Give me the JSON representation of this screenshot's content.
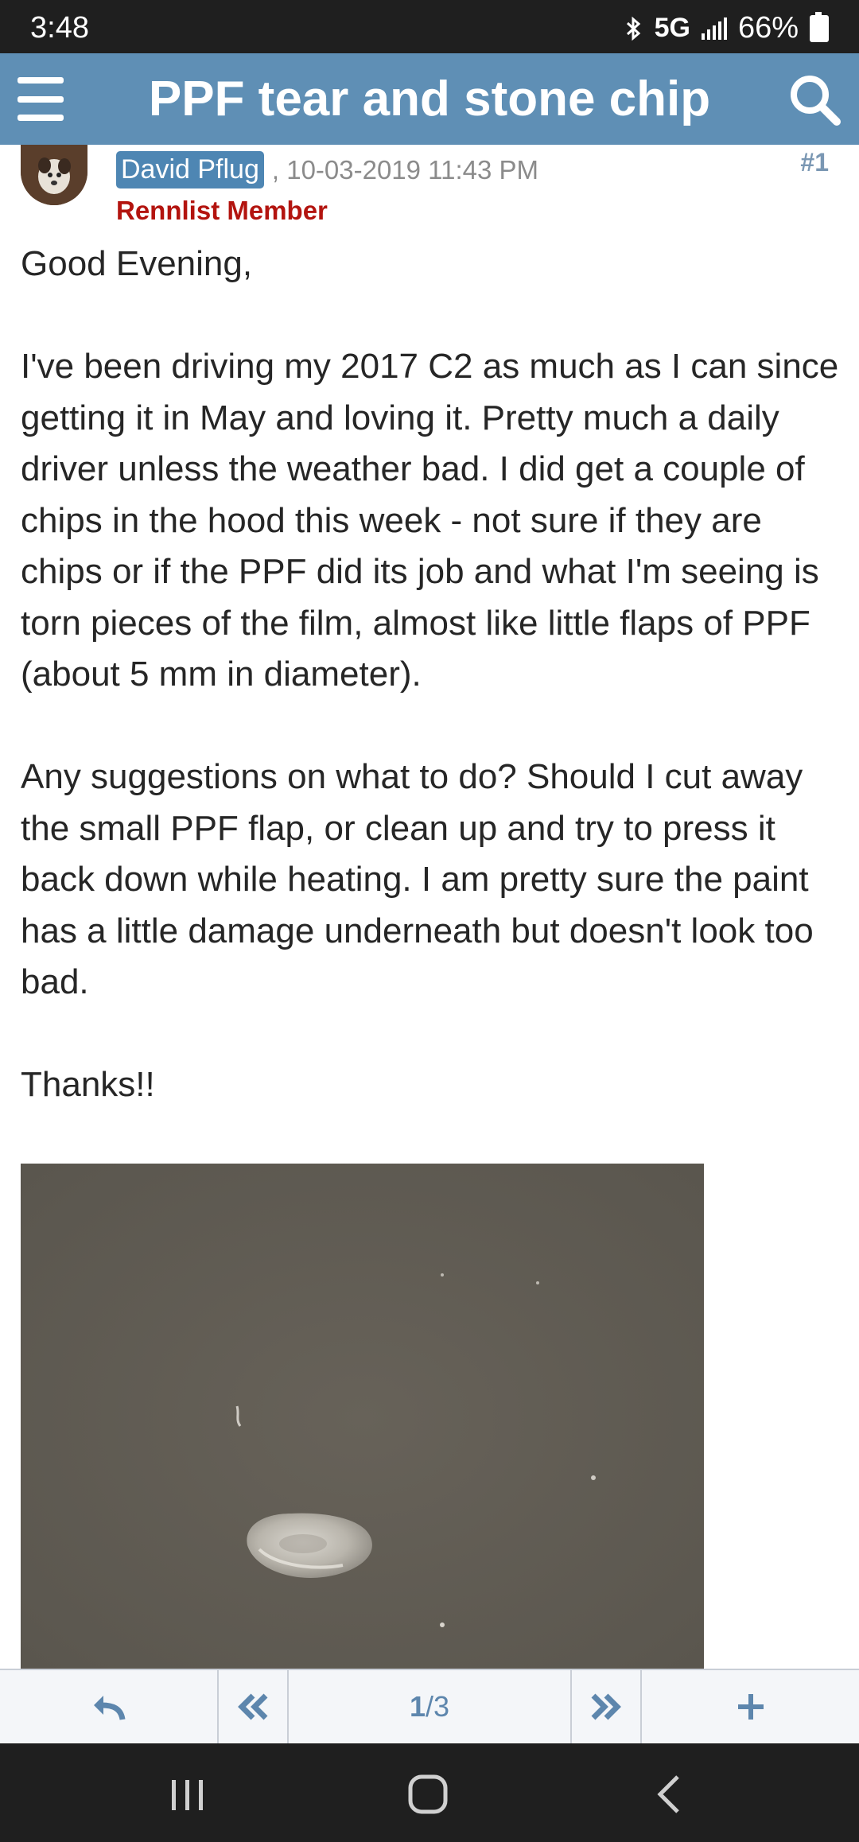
{
  "status_bar": {
    "time": "3:48",
    "network": "5G",
    "battery": "66%",
    "icons": [
      "bluetooth-icon",
      "signal-icon",
      "battery-icon"
    ]
  },
  "app_bar": {
    "title": "PPF tear and stone chip",
    "menu_icon": "menu-icon",
    "search_icon": "search-icon",
    "background": "#5f8fb5"
  },
  "post": {
    "author": "David Pflug",
    "date": ", 10-03-2019 11:43 PM",
    "number": "#1",
    "member_title": "Rennlist Member",
    "paragraphs": [
      "Good Evening,",
      "I've been driving my 2017 C2 as much as I can since getting it in May and loving it. Pretty much a daily driver unless the weather bad. I did get a couple of chips in the hood this week - not sure if they are chips or if the PPF did its job and what I'm seeing is torn pieces of the film, almost like little flaps of PPF (about 5 mm in diameter).",
      "Any suggestions on what to do? Should I cut away the small PPF flap, or clean up and try to press it back down while heating. I am pretty sure the paint has a little damage underneath but doesn't look too bad.",
      "Thanks!!"
    ]
  },
  "pagination": {
    "current": "1",
    "separator": "/",
    "total": "3",
    "icons": [
      "reply-icon",
      "first-page-icon",
      "last-page-icon",
      "add-icon"
    ],
    "accent": "#5d86ad"
  },
  "system_nav": {
    "icons": [
      "recent-apps-icon",
      "home-icon",
      "back-icon"
    ]
  }
}
